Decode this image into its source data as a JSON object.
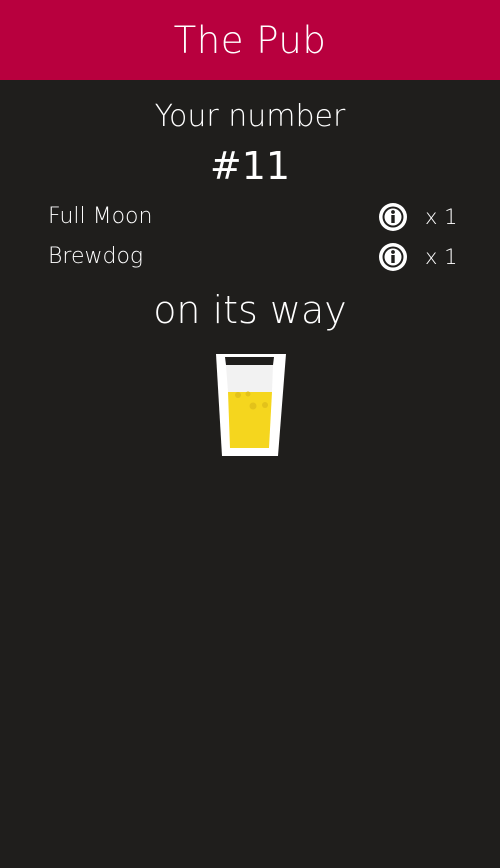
{
  "header": {
    "title": "The Pub",
    "color": "#b8003e"
  },
  "order": {
    "label": "Your number",
    "number": "#11",
    "items": [
      {
        "name": "Full Moon",
        "qty": "x 1",
        "info_icon": "info-icon"
      },
      {
        "name": "Brewdog",
        "qty": "x 1",
        "info_icon": "info-icon"
      }
    ],
    "status": "on its way"
  },
  "illustration": {
    "icon": "beer-glass-icon",
    "beer_color": "#f5d61e",
    "foam_color": "#f2f2f2"
  },
  "colors": {
    "background": "#1f1e1c",
    "text": "#ffffff"
  }
}
